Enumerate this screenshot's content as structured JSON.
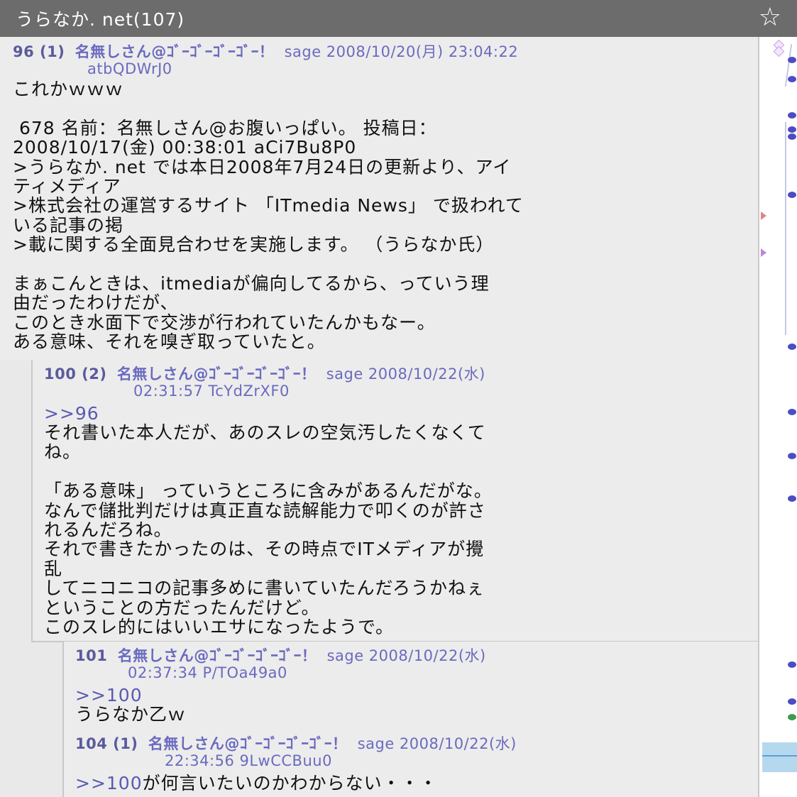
{
  "titlebar": {
    "title": "うらなか. net(107)",
    "star_icon": "star-outline-icon"
  },
  "posts": [
    {
      "header_num": "96 (1)",
      "header_name": "名無しさん@ｺﾞｰｺﾞｰｺﾞｰｺﾞｰ！",
      "header_meta": "sage 2008/10/20(月) 23:04:22",
      "header_id": "atbQDWrJ0",
      "body": "これかｗｗｗ\n\n 678 名前：名無しさん@お腹いっぱい。 投稿日：\n2008/10/17(金) 00:38:01 aCi7Bu8P0\n>うらなか. net では本日2008年7月24日の更新より、アイ\nティメディア\n>株式会社の運営するサイト 「ITmedia News」 で扱われて\nいる記事の掲\n>載に関する全面見合わせを実施します。 （うらなか氏）\n\nまぁこんときは、itmediaが偏向してるから、っていう理\n由だったわけだが、\nこのとき水面下で交渉が行われていたんかもなー。\nある意味、それを嗅ぎ取っていたと。"
    },
    {
      "header_num": "100 (2)",
      "header_name": "名無しさん@ｺﾞｰｺﾞｰｺﾞｰｺﾞｰ！",
      "header_meta": "sage 2008/10/22(水)",
      "header_id": "02:31:57 TcYdZrXF0",
      "anchor": ">>96",
      "body": "それ書いた本人だが、あのスレの空気汚したくなくて\nね。\n\n「ある意味」 っていうところに含みがあるんだがな。\nなんで儲批判だけは真正直な読解能力で叩くのが許さ\nれるんだろね。\nそれで書きたかったのは、その時点でITメディアが攪\n乱\nしてニコニコの記事多めに書いていたんだろうかねぇ\nということの方だったんだけど。\nこのスレ的にはいいエサになったようで。"
    },
    {
      "header_num": "101",
      "header_name": "名無しさん@ｺﾞｰｺﾞｰｺﾞｰｺﾞｰ！",
      "header_meta": "sage 2008/10/22(水)",
      "header_id": "02:37:34 P/TOa49a0",
      "anchor": ">>100",
      "body": "うらなか乙ｗ"
    },
    {
      "header_num": "104 (1)",
      "header_name": "名無しさん@ｺﾞｰｺﾞｰｺﾞｰｺﾞｰ！",
      "header_meta": "sage 2008/10/22(水)",
      "header_id": "22:34:56 9LwCCBuu0",
      "anchor": ">>100",
      "body": "が何言いたいのかわからない・・・"
    }
  ],
  "colors": {
    "titlebar": "#6c6c6c",
    "header": "#6a6ac0",
    "rail_dot": "#4c4cc4"
  }
}
